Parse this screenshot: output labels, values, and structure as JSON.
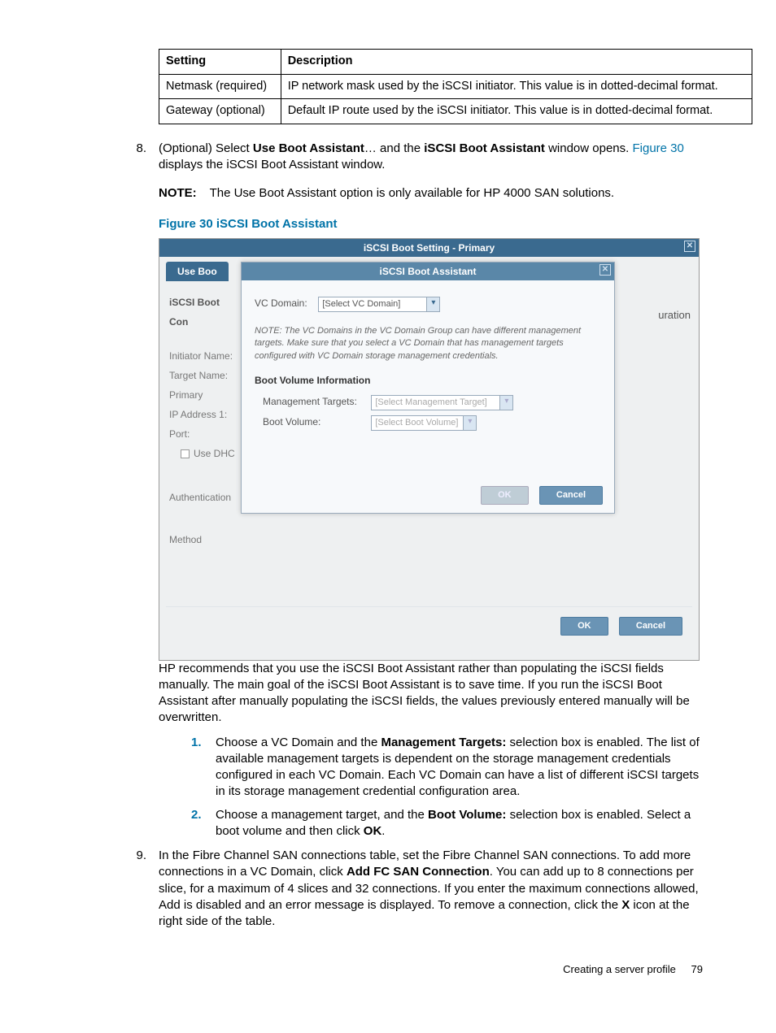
{
  "table": {
    "headers": [
      "Setting",
      "Description"
    ],
    "rows": [
      {
        "setting": "Netmask (required)",
        "desc": "IP network mask used by the iSCSI initiator. This value is in dotted-decimal format."
      },
      {
        "setting": "Gateway (optional)",
        "desc": "Default IP route used by the iSCSI initiator. This value is in dotted-decimal format."
      }
    ]
  },
  "step8": {
    "num": "8.",
    "pre": "(Optional) Select ",
    "b1": "Use Boot Assistant",
    "mid": "… and the ",
    "b2": "iSCSI Boot Assistant",
    "post1": " window opens. ",
    "link": "Figure 30",
    "post2": " displays the iSCSI Boot Assistant window."
  },
  "note": {
    "label": "NOTE:",
    "text": "The Use Boot Assistant option is only available for HP 4000 SAN solutions."
  },
  "fig_caption": "Figure 30 iSCSI Boot Assistant",
  "mock": {
    "outer_title": "iSCSI Boot Setting - Primary",
    "tab": "Use Boo",
    "right_frag": "uration",
    "left": {
      "header": "iSCSI Boot Con",
      "l1": "Initiator Name:",
      "l2": "Target Name:",
      "l3": "Primary",
      "l4": "IP Address 1:",
      "l5": "Port:",
      "l6": "Use DHC",
      "auth": "Authentication",
      "method": "Method"
    },
    "inner": {
      "title": "iSCSI Boot Assistant",
      "vcdomain_label": "VC Domain:",
      "vcdomain_sel": "[Select VC Domain]",
      "note": "NOTE: The VC Domains in the VC Domain Group can have different management targets. Make sure that you select a VC Domain that has management targets configured with VC Domain storage management credentials.",
      "sec": "Boot Volume Information",
      "mt_label": "Management Targets:",
      "mt_sel": "[Select Management Target]",
      "bv_label": "Boot Volume:",
      "bv_sel": "[Select Boot Volume]",
      "ok": "OK",
      "cancel": "Cancel"
    },
    "outer_ok": "OK",
    "outer_cancel": "Cancel"
  },
  "para_rec": "HP recommends that you use the iSCSI Boot Assistant rather than populating the iSCSI fields manually. The main goal of the iSCSI Boot Assistant is to save time. If you run the iSCSI Boot Assistant after manually populating the iSCSI fields, the values previously entered manually will be overwritten.",
  "sub1": {
    "num": "1.",
    "t1": "Choose a VC Domain and the ",
    "b1": "Management Targets:",
    "t2": " selection box is enabled. The list of available management targets is dependent on the storage management credentials configured in each VC Domain. Each VC Domain can have a list of different iSCSI targets in its storage management credential configuration area."
  },
  "sub2": {
    "num": "2.",
    "t1": "Choose a management target, and the ",
    "b1": "Boot Volume:",
    "t2": " selection box is enabled. Select a boot volume and then click ",
    "b2": "OK",
    "t3": "."
  },
  "step9": {
    "num": "9.",
    "t1": "In the Fibre Channel SAN connections table, set the Fibre Channel SAN connections. To add more connections in a VC Domain, click ",
    "b1": "Add FC SAN Connection",
    "t2": ". You can add up to 8 connections per slice, for a maximum of 4 slices and 32 connections. If you enter the maximum connections allowed, Add is disabled and an error message is displayed. To remove a connection, click the ",
    "b2": "X",
    "t3": " icon at the right side of the table."
  },
  "footer": {
    "text": "Creating a server profile",
    "page": "79"
  }
}
